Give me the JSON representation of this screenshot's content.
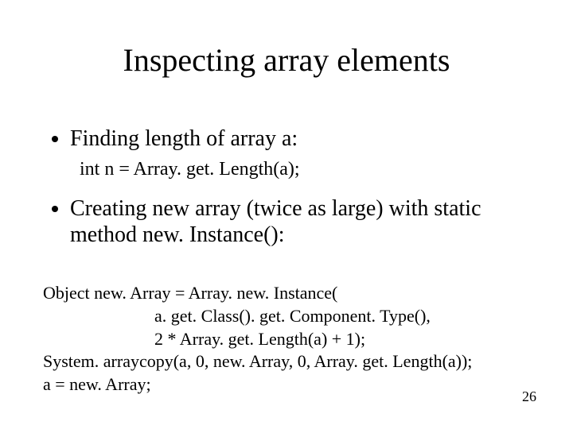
{
  "title": "Inspecting array elements",
  "bullet1": "Finding length of array a:",
  "sub1": "int n = Array. get. Length(a);",
  "bullet2": "Creating new array (twice as large) with static method new. Instance():",
  "code": {
    "l1": "Object new. Array = Array. new. Instance(",
    "l2": "a. get. Class(). get. Component. Type(),",
    "l3": "2 * Array. get. Length(a) + 1);",
    "l4": "System. arraycopy(a, 0, new. Array, 0, Array. get. Length(a));",
    "l5": "a = new. Array;"
  },
  "page": "26"
}
